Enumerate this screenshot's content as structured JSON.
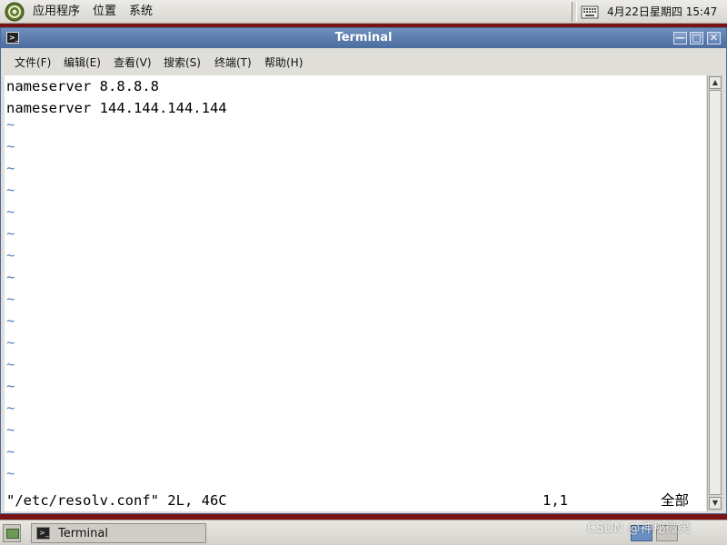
{
  "top_panel": {
    "menus": [
      "应用程序",
      "位置",
      "系统"
    ],
    "clock": "4月22日星期四 15:47"
  },
  "window": {
    "title": "Terminal",
    "buttons": {
      "minimize": "—",
      "maximize": "□",
      "close": "✕"
    },
    "menubar": [
      "文件(F)",
      "编辑(E)",
      "查看(V)",
      "搜索(S)",
      "终端(T)",
      "帮助(H)"
    ]
  },
  "terminal": {
    "lines": [
      "nameserver 8.8.8.8",
      "nameserver 144.144.144.144"
    ],
    "tilde": "~",
    "status_left": "\"/etc/resolv.conf\" 2L, 46C",
    "status_position": "1,1",
    "status_percent": "全部"
  },
  "bottom_panel": {
    "task_label": "Terminal",
    "watermark": "CSDN @神秘微笑"
  },
  "colors": {
    "desktop": "#7a1414",
    "titlebar": "#4b6c9e",
    "tilde": "#4d7fb0"
  }
}
